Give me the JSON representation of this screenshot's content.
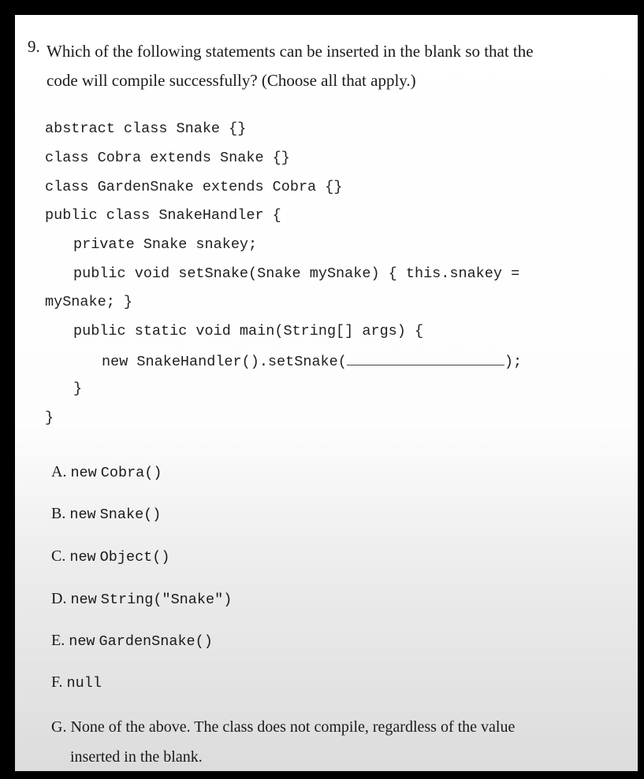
{
  "question": {
    "number": "9.",
    "line1": "Which of the following statements can be inserted in the blank so that the",
    "line2": "code will compile successfully? (Choose all that apply.)"
  },
  "code_lines": {
    "l1": "abstract class Snake {}",
    "l2": "class Cobra extends Snake {}",
    "l3": "class GardenSnake extends Cobra {}",
    "l4": "public class SnakeHandler {",
    "l5": "private Snake snakey;",
    "l6": "public void setSnake(Snake mySnake) { this.snakey =",
    "l7": "mySnake; }",
    "l8": "public static void main(String[] args) {",
    "l9_before": "new SnakeHandler().setSnake(",
    "l9_after": ");",
    "l10": "}",
    "l11": "}"
  },
  "options": {
    "a": {
      "letter": "A.",
      "pre": "new",
      "code": "Cobra()"
    },
    "b": {
      "letter": "B.",
      "pre": "new",
      "code": "Snake()"
    },
    "c": {
      "letter": "C.",
      "pre": "new",
      "code": "Object()"
    },
    "d": {
      "letter": "D.",
      "pre": "new",
      "code": "String(\"Snake\")"
    },
    "e": {
      "letter": "E.",
      "pre": "new",
      "code": "GardenSnake()"
    },
    "f": {
      "letter": "F.",
      "pre": "",
      "code": "null"
    },
    "g": {
      "letter": "G.",
      "line1": "None of the above. The class does not compile, regardless of the value",
      "line2": "inserted in the blank."
    }
  }
}
